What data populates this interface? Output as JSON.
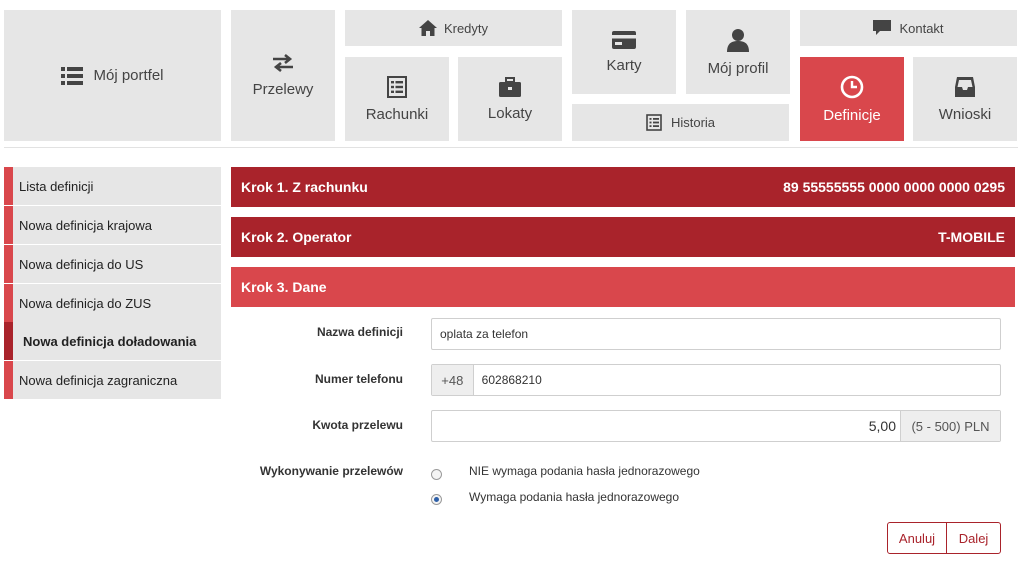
{
  "nav": {
    "portfel": "Mój portfel",
    "przelewy": "Przelewy",
    "kredyty": "Kredyty",
    "rachunki": "Rachunki",
    "lokaty": "Lokaty",
    "karty": "Karty",
    "historia": "Historia",
    "profil": "Mój profil",
    "kontakt": "Kontakt",
    "definicje": "Definicje",
    "wnioski": "Wnioski",
    "active": "definicje"
  },
  "sidebar": {
    "items": [
      {
        "label": "Lista definicji"
      },
      {
        "label": "Nowa definicja krajowa"
      },
      {
        "label": "Nowa definicja do US"
      },
      {
        "label": "Nowa definicja do ZUS"
      },
      {
        "label": "Nowa definicja doładowania"
      },
      {
        "label": "Nowa definicja zagraniczna"
      }
    ]
  },
  "steps": {
    "step1": {
      "label": "Krok 1. Z rachunku",
      "value": "89 55555555 0000 0000 0000 0295"
    },
    "step2": {
      "label": "Krok 2. Operator",
      "value": "T-MOBILE"
    },
    "step3": {
      "label": "Krok 3. Dane"
    }
  },
  "form": {
    "name_label": "Nazwa definicji",
    "name_value": "oplata za telefon",
    "phone_label": "Numer telefonu",
    "phone_prefix": "+48",
    "phone_value": "602868210",
    "amount_label": "Kwota przelewu",
    "amount_value": "5,00",
    "amount_range": "(5 - 500) PLN",
    "exec_label": "Wykonywanie przelewów",
    "option_no_otp": "NIE wymaga podania hasła jednorazowego",
    "option_otp": "Wymaga podania hasła jednorazowego",
    "selected_option": "option_otp"
  },
  "buttons": {
    "cancel": "Anuluj",
    "next": "Dalej"
  },
  "colors": {
    "accent": "#d9474c",
    "accent_dark": "#a9232b",
    "tile_bg": "#e6e6e6"
  }
}
